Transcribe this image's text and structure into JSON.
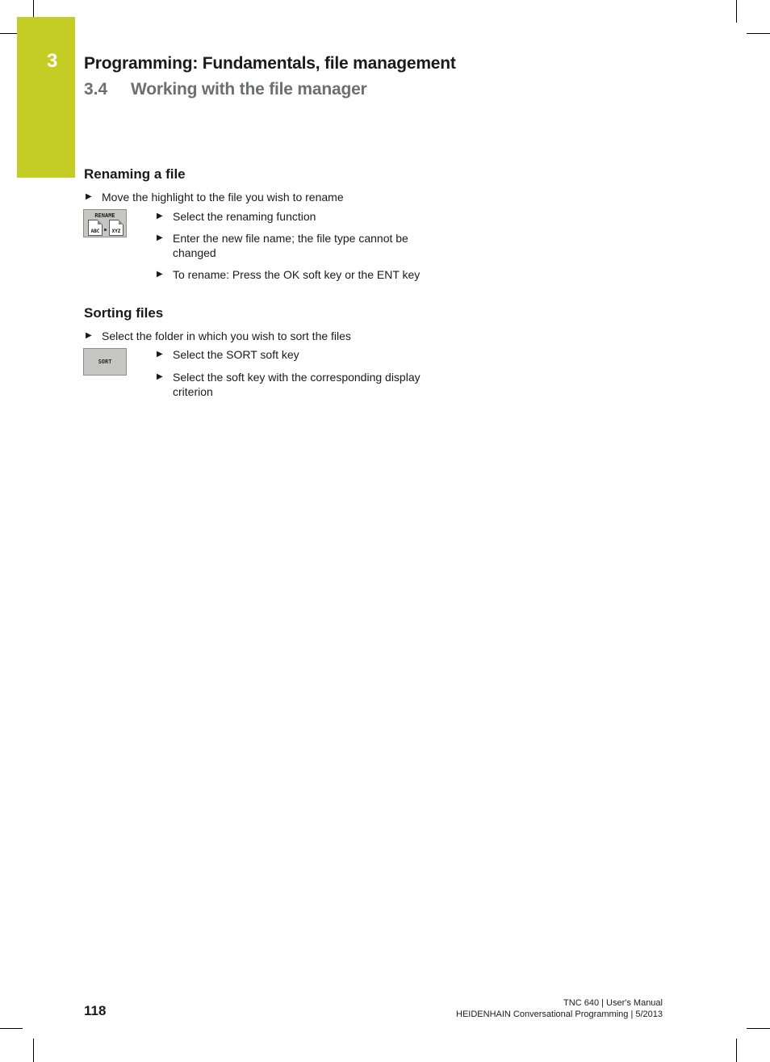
{
  "header": {
    "chapter_number": "3",
    "chapter_title": "Programming: Fundamentals, file management",
    "section_number": "3.4",
    "section_title": "Working with the file manager",
    "accent_color": "#c3cd24"
  },
  "sections": [
    {
      "heading": "Renaming a file",
      "intro_step": "Move the highlight to the file you wish to rename",
      "softkey": {
        "label": "RENAME",
        "icon_left_text": "ABC",
        "icon_right_text": "XYZ"
      },
      "steps": [
        "Select the renaming function",
        "Enter the new file name; the file type cannot be changed",
        "To rename: Press the OK soft key or the ENT key"
      ]
    },
    {
      "heading": "Sorting files",
      "intro_step": "Select the folder in which you wish to sort the files",
      "softkey": {
        "label": "SORT"
      },
      "steps": [
        "Select the SORT soft key",
        "Select the soft key with the corresponding display criterion"
      ]
    }
  ],
  "icons": {
    "bullet": "▶"
  },
  "footer": {
    "page_number": "118",
    "line1": "TNC 640 | User's Manual",
    "line2": "HEIDENHAIN Conversational Programming | 5/2013"
  }
}
